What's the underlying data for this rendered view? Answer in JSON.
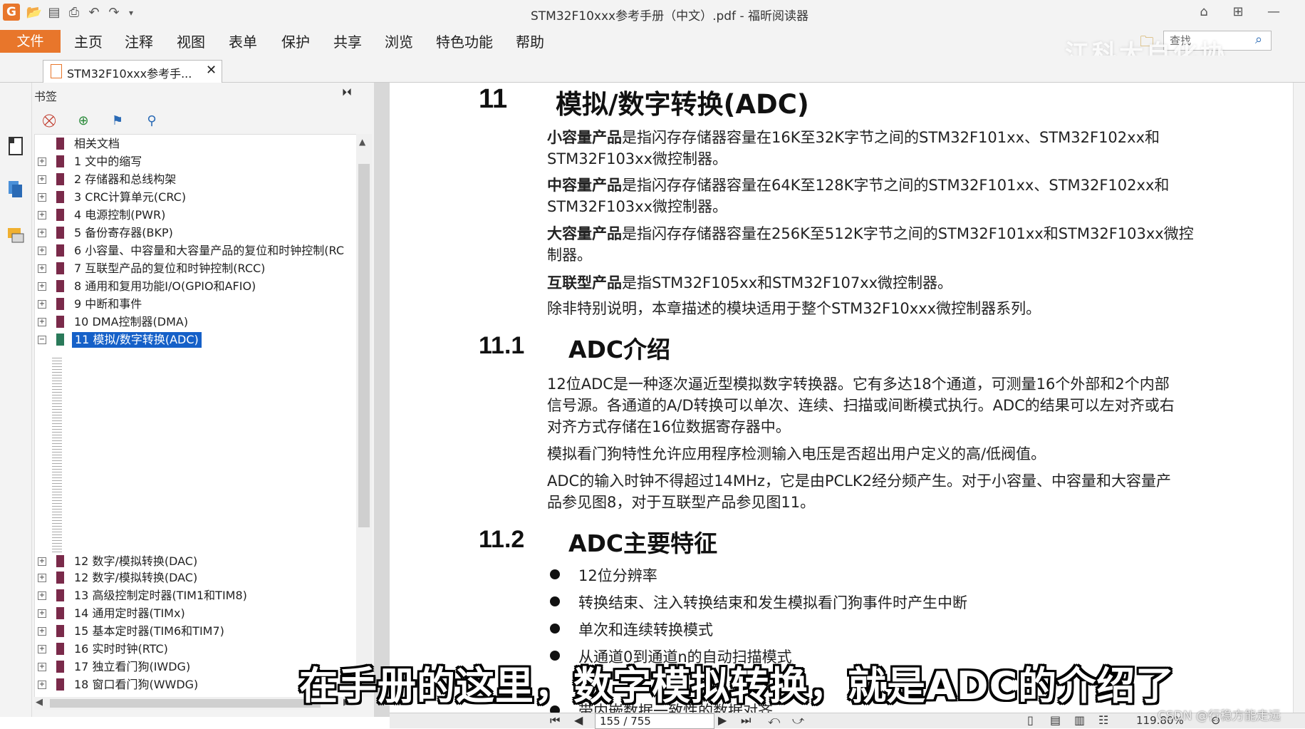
{
  "titlebar": {
    "title": "STM32F10xxx参考手册（中文）.pdf - 福昕阅读器",
    "logo": "G"
  },
  "menu": {
    "file": "文件",
    "items": [
      "主页",
      "注释",
      "视图",
      "表单",
      "保护",
      "共享",
      "浏览",
      "特色功能",
      "帮助"
    ]
  },
  "search": {
    "placeholder": "查找"
  },
  "watermark_top": "江科大自化协",
  "doc_tab": {
    "label": "STM32F10xxx参考手..."
  },
  "bookmarks": {
    "header": "书签",
    "items": [
      "相关文档",
      "1 文中的缩写",
      "2 存储器和总线构架",
      "3 CRC计算单元(CRC)",
      "4 电源控制(PWR)",
      "5 备份寄存器(BKP)",
      "6 小容量、中容量和大容量产品的复位和时钟控制(RC",
      "7 互联型产品的复位和时钟控制(RCC)",
      "8 通用和复用功能I/O(GPIO和AFIO)",
      "9 中断和事件",
      "10 DMA控制器(DMA)",
      "11 模拟/数字转换(ADC)"
    ],
    "items_bottom": [
      "12 数字/模拟转换(DAC)",
      "12 数字/模拟转换(DAC)",
      "13 高级控制定时器(TIM1和TIM8)",
      "14 通用定时器(TIMx)",
      "15 基本定时器(TIM6和TIM7)",
      "16 实时时钟(RTC)",
      "17 独立看门狗(IWDG)",
      "18 窗口看门狗(WWDG)"
    ]
  },
  "document": {
    "h11_num": "11",
    "h11_title": "模拟/数字转换(ADC)",
    "p1_bold": "小容量产品",
    "p1_a": "是指闪存存储器容量在16K至32K字节之间的STM32F101xx、STM32F102xx和",
    "p1_b": "STM32F103xx微控制器。",
    "p2_bold": "中容量产品",
    "p2_a": "是指闪存存储器容量在64K至128K字节之间的STM32F101xx、STM32F102xx和",
    "p2_b": "STM32F103xx微控制器。",
    "p3_bold": "大容量产品",
    "p3_a": "是指闪存存储器容量在256K至512K字节之间的STM32F101xx和STM32F103xx微控",
    "p3_b": "制器。",
    "p4_bold": "互联型产品",
    "p4_a": "是指STM32F105xx和STM32F107xx微控制器。",
    "p5": "除非特别说明，本章描述的模块适用于整个STM32F10xxx微控制器系列。",
    "h111_num": "11.1",
    "h111_title": "ADC介绍",
    "p6_a": "12位ADC是一种逐次逼近型模拟数字转换器。它有多达18个通道，可测量16个外部和2个内部",
    "p6_b": "信号源。各通道的A/D转换可以单次、连续、扫描或间断模式执行。ADC的结果可以左对齐或右",
    "p6_c": "对齐方式存储在16位数据寄存器中。",
    "p7": "模拟看门狗特性允许应用程序检测输入电压是否超出用户定义的高/低阀值。",
    "p8_a": "ADC的输入时钟不得超过14MHz，它是由PCLK2经分频产生。对于小容量、中容量和大容量产",
    "p8_b": "品参见图8，对于互联型产品参见图11。",
    "h112_num": "11.2",
    "h112_title": "ADC主要特征",
    "bullets": [
      "12位分辨率",
      "转换结束、注入转换结束和发生模拟看门狗事件时产生中断",
      "单次和连续转换模式",
      "从通道0到通道n的自动扫描模式",
      "带内嵌数据一致性的数据对齐"
    ]
  },
  "subtitle": "在手册的这里，数字模拟转换，就是ADC的介绍了",
  "status": {
    "page": "155 / 755",
    "zoom": "119.80%"
  },
  "credit": "CSDN @行稳方能走远",
  "colors": {
    "accent": "#e8762b",
    "selection": "#1560c8",
    "bookmark_flag": "#7a2a4a"
  }
}
